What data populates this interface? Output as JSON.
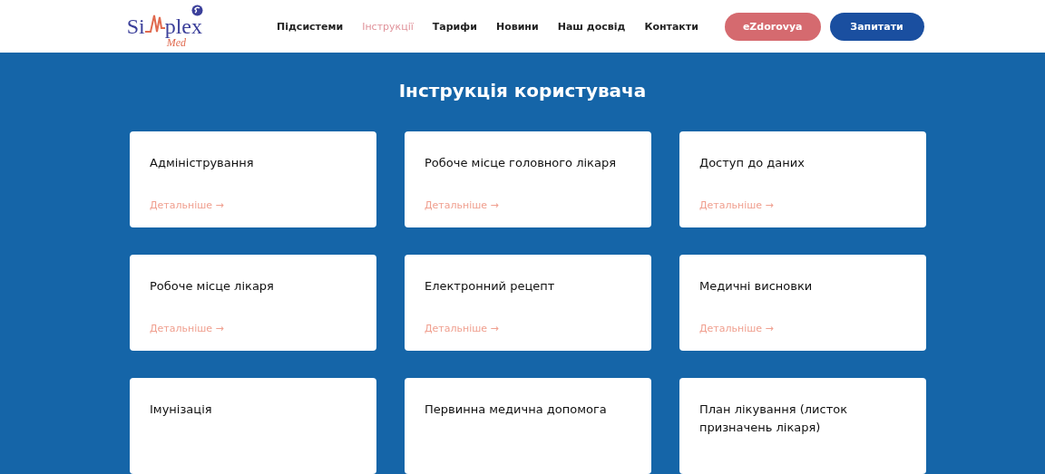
{
  "logo": {
    "prefix": "Si",
    "suffix": "plex",
    "sub": "Med"
  },
  "nav": [
    {
      "label": "Підсистеми",
      "selected": false
    },
    {
      "label": "Інструкції",
      "selected": true
    },
    {
      "label": "Тарифи",
      "selected": false
    },
    {
      "label": "Новини",
      "selected": false
    },
    {
      "label": "Наш досвід",
      "selected": false
    },
    {
      "label": "Контакти",
      "selected": false
    }
  ],
  "buttons": [
    {
      "label": "eZdorovya",
      "kind": "secondary"
    },
    {
      "label": "Запитати",
      "kind": "primary"
    }
  ],
  "title": "Інструкція користувача",
  "cards": [
    {
      "title": "Адміністрування",
      "link": "Детальніше →"
    },
    {
      "title": "Робоче місце головного лікаря",
      "link": "Детальніше →"
    },
    {
      "title": "Доступ до даних",
      "link": "Детальніше →"
    },
    {
      "title": "Робоче місце лікаря",
      "link": "Детальніше →"
    },
    {
      "title": "Електронний рецепт",
      "link": "Детальніше →"
    },
    {
      "title": "Медичні висновки",
      "link": "Детальніше →"
    },
    {
      "title": "Імунізація"
    },
    {
      "title": "Первинна медична допомога"
    },
    {
      "title": "План лікування (листок призначень лікаря)"
    }
  ]
}
